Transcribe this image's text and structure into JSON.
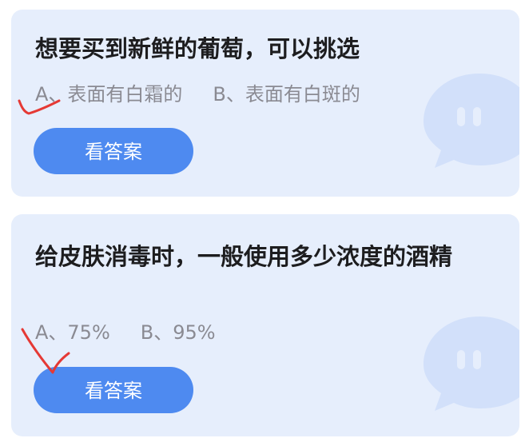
{
  "cards": [
    {
      "question": "想要买到新鲜的葡萄，可以挑选",
      "option_a": "A、表面有白霜的",
      "option_b": "B、表面有白斑的",
      "button_label": "看答案"
    },
    {
      "question": "给皮肤消毒时，一般使用多少浓度的酒精",
      "option_a": "A、75%",
      "option_b": "B、95%",
      "button_label": "看答案"
    }
  ],
  "colors": {
    "card_bg": "#e6eefc",
    "button_bg": "#4e8af0",
    "annotation": "#e53935"
  },
  "icons": [
    "chat-bubble-icon",
    "checkmark-icon"
  ]
}
